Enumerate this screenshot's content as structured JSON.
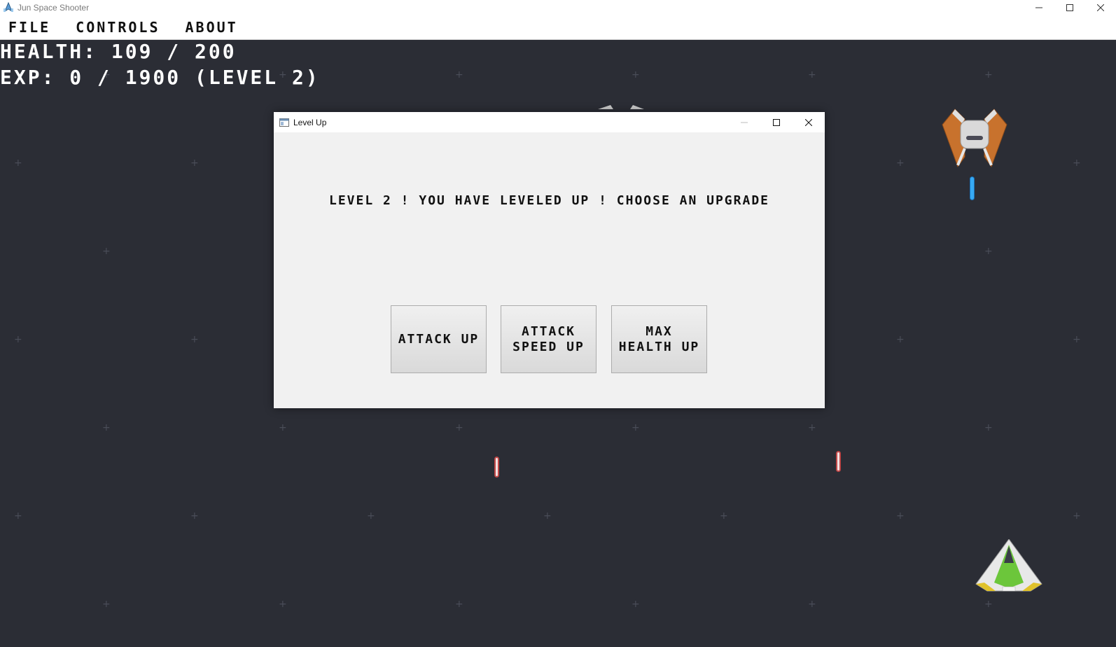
{
  "window": {
    "title": "Jun Space Shooter"
  },
  "menu": [
    "FILE",
    "CONTROLS",
    "ABOUT"
  ],
  "hud": {
    "health": "HEALTH: 109 / 200",
    "exp": "EXP: 0 / 1900 (LEVEL 2)"
  },
  "dialog": {
    "title": "Level Up",
    "message": "LEVEL 2 ! YOU HAVE LEVELED UP ! CHOOSE AN UPGRADE",
    "buttons": [
      "ATTACK UP",
      "ATTACK SPEED UP",
      "MAX HEALTH UP"
    ]
  },
  "colors": {
    "background": "#2b2d35",
    "player_ship": "#6cc63b",
    "enemy_ship": "#c8722d",
    "enemy_bullet": "#37a9f3",
    "player_bullet": "#c04848"
  }
}
